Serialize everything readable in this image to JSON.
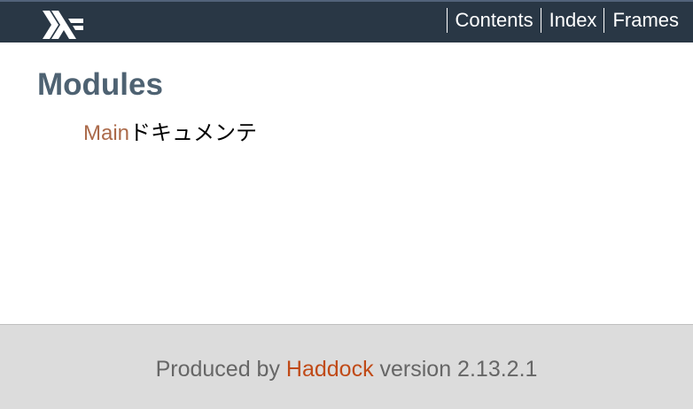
{
  "header": {
    "logo_icon": "haskell-logo-icon",
    "background_color": "#293745",
    "links": [
      {
        "label": "Contents"
      },
      {
        "label": "Index"
      },
      {
        "label": "Frames"
      }
    ]
  },
  "main": {
    "title": "Modules",
    "modules": [
      {
        "name": "Main",
        "description": "ドキュメンテ"
      }
    ]
  },
  "footer": {
    "prefix": "Produced by ",
    "link_label": "Haddock",
    "suffix": " version 2.13.2.1"
  },
  "colors": {
    "title": "#4e6272",
    "module_link": "#ab6a4a",
    "footer_link": "#c04a17",
    "footer_bg": "#dcdcdc"
  }
}
